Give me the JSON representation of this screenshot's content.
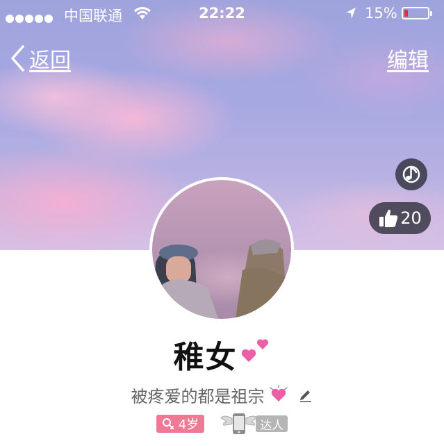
{
  "status_bar": {
    "carrier": "中国联通",
    "time": "22:22",
    "battery_percent": "15%",
    "battery_level": 0.15,
    "signal_bars": 5,
    "battery_color": "#e0303a"
  },
  "nav": {
    "back_label": "返回",
    "edit_label": "编辑"
  },
  "actions": {
    "like_count": "20",
    "music_icon": "music-note-icon",
    "like_icon": "thumbs-up-icon"
  },
  "profile": {
    "name": "稚女",
    "signature": "被疼爱的都是祖宗",
    "age_tag": "4岁",
    "expert_tag": "达人",
    "accent_color": "#f07a96"
  }
}
